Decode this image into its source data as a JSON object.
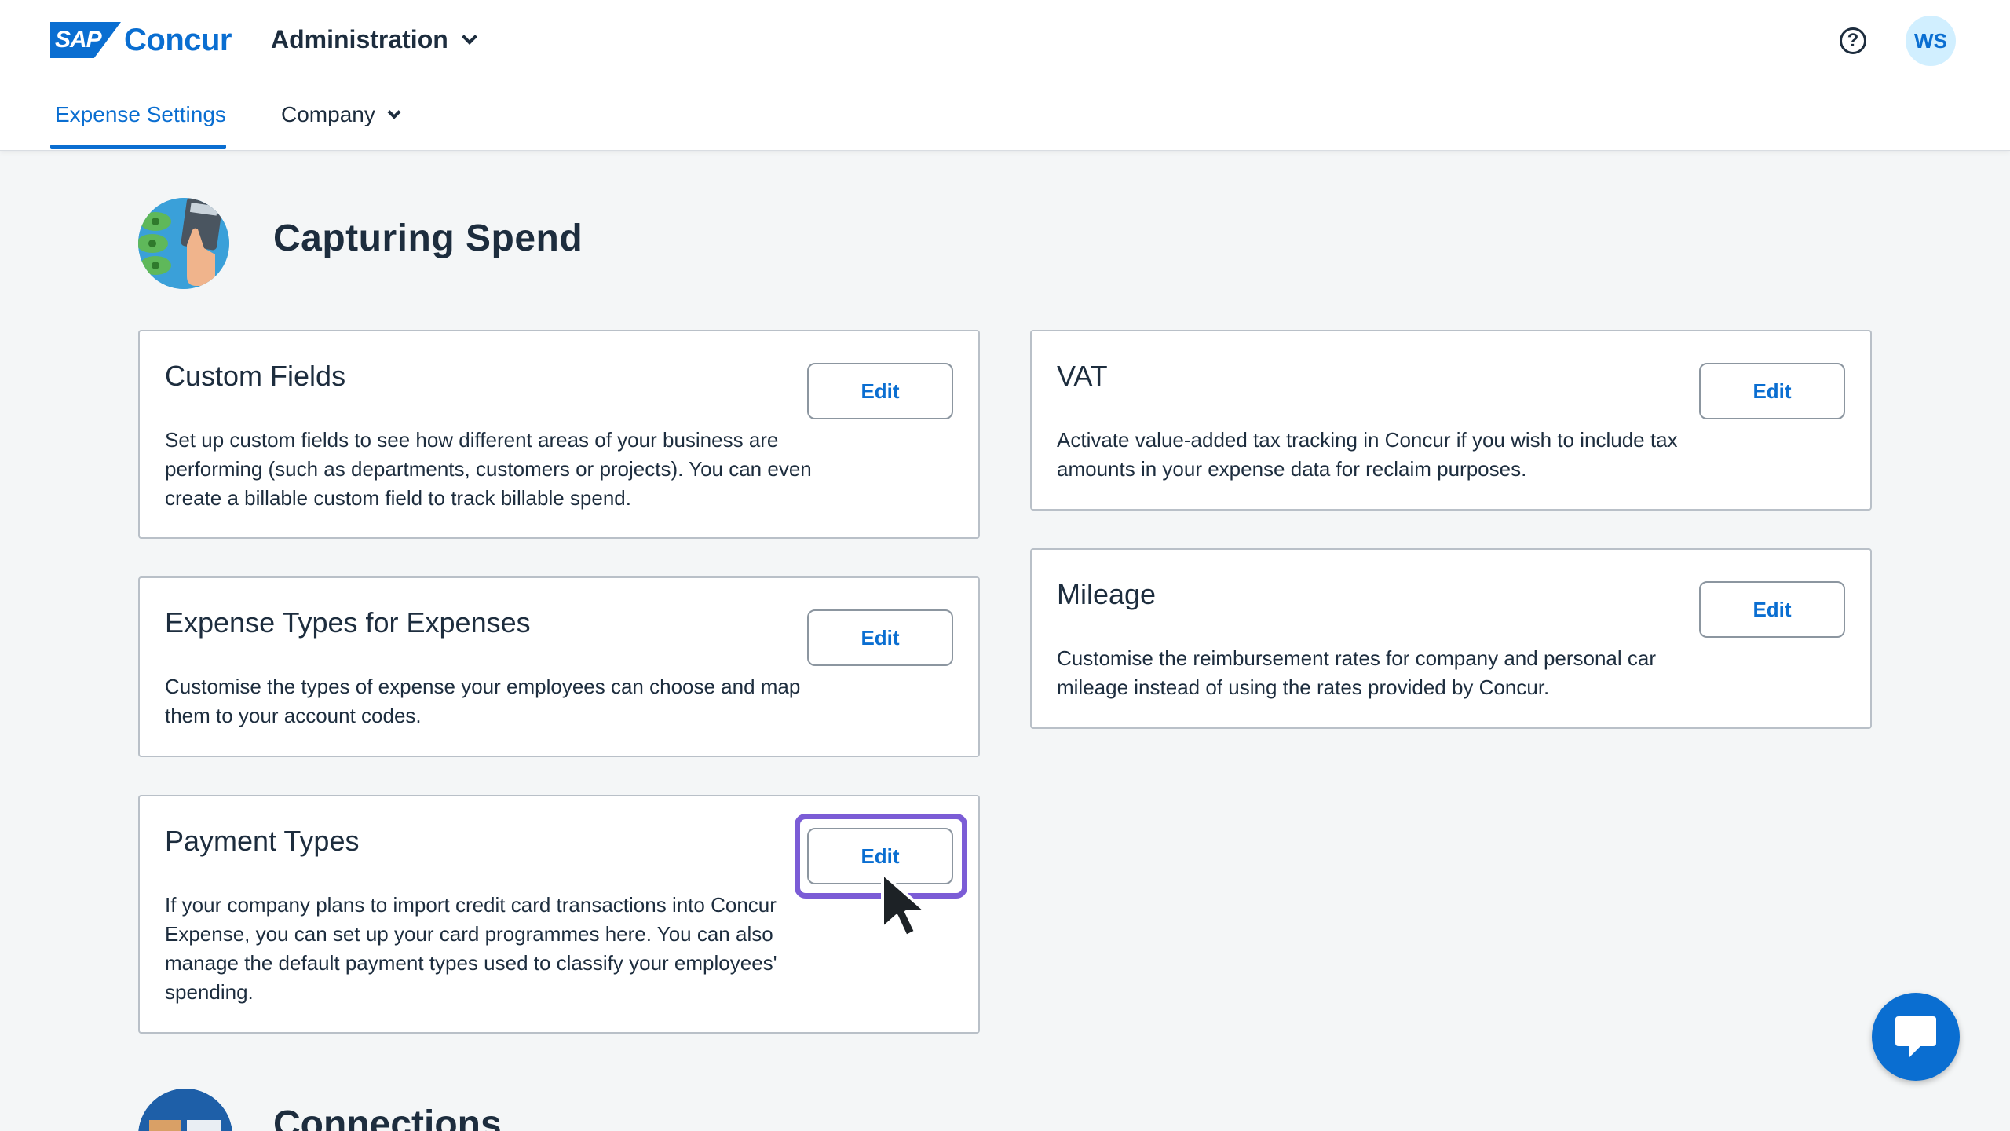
{
  "header": {
    "logo_sap": "SAP",
    "logo_concur": "Concur",
    "admin_menu": "Administration",
    "user_initials": "WS"
  },
  "tabs": [
    {
      "label": "Expense Settings",
      "active": true
    },
    {
      "label": "Company",
      "active": false
    }
  ],
  "section": {
    "title": "Capturing Spend"
  },
  "cards": [
    {
      "title": "Custom Fields",
      "desc": "Set up custom fields to see how different areas of your business are performing (such as departments, customers or projects). You can even create a billable custom field to track billable spend.",
      "button": "Edit"
    },
    {
      "title": "Expense Types for Expenses",
      "desc": "Customise the types of expense your employees can choose and map them to your account codes.",
      "button": "Edit"
    },
    {
      "title": "Payment Types",
      "desc": "If your company plans to import credit card transactions into Concur Expense, you can set up your card programmes here. You can also manage the default payment types used to classify your employees' spending.",
      "button": "Edit"
    },
    {
      "title": "VAT",
      "desc": "Activate value-added tax tracking in Concur if you wish to include tax amounts in your expense data for reclaim purposes.",
      "button": "Edit"
    },
    {
      "title": "Mileage",
      "desc": "Customise the reimbursement rates for company and personal car mileage instead of using the rates provided by Concur.",
      "button": "Edit"
    }
  ],
  "section2": {
    "title": "Connections"
  },
  "colors": {
    "accent": "#0a6ed1",
    "highlight": "#7b5cd6"
  }
}
